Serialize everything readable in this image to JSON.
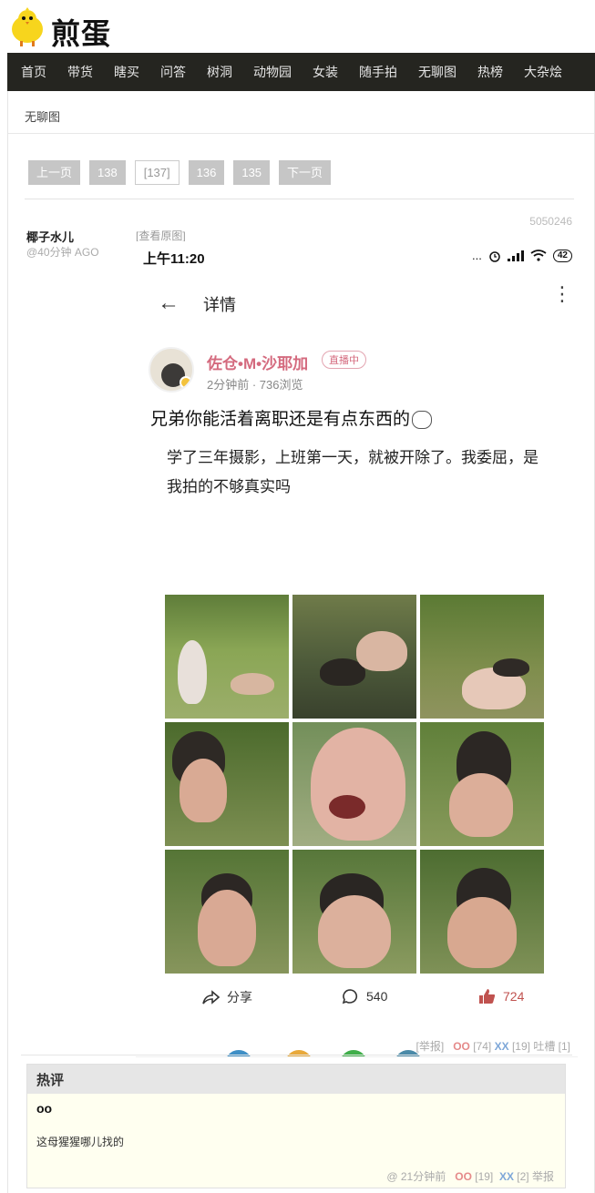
{
  "site": {
    "logo_text": "煎蛋"
  },
  "nav": [
    "首页",
    "带货",
    "瞎买",
    "问答",
    "树洞",
    "动物园",
    "女装",
    "随手拍",
    "无聊图",
    "热榜",
    "大杂烩"
  ],
  "breadcrumb": "无聊图",
  "pager": {
    "prev": "上一页",
    "pages": [
      "138",
      "[137]",
      "136",
      "135"
    ],
    "next": "下一页"
  },
  "post": {
    "author": "椰子水儿",
    "time": "@40分钟 AGO",
    "view_original": "[查看原图]",
    "id": "5050246",
    "votes": {
      "report": "[举报]",
      "oo_label": "OO",
      "oo_count": "[74]",
      "xx_label": "XX",
      "xx_count": "[19]",
      "tucao": "吐槽 [1]"
    }
  },
  "screenshot": {
    "status_time": "上午11:20",
    "status_extra": "...",
    "battery": "42",
    "header_title": "详情",
    "user_name": "佐仓•M•沙耶加",
    "live_tag": "直播中",
    "meta": "2分钟前 · 736浏览",
    "line1": "兄弟你能活着离职还是有点东西的",
    "line2": "学了三年摄影，上班第一天，就被开除了。我委屈，是我拍的不够真实吗",
    "share_label": "分享",
    "comment_count": "540",
    "like_count": "724",
    "forward_label": "转发",
    "comment_label": "评论",
    "like_label": "点赞",
    "colors": {
      "accent_pink": "#d46a7e",
      "like_red": "#c0524f"
    }
  },
  "hot_comments": {
    "title": "热评",
    "items": [
      {
        "user": "oo",
        "text": "这母猩猩哪儿找的",
        "meta_prefix": "@ 21分钟前",
        "oo_label": "OO",
        "oo_count": "[19]",
        "xx_label": "XX",
        "xx_count": "[2]",
        "report": "举报"
      }
    ]
  }
}
